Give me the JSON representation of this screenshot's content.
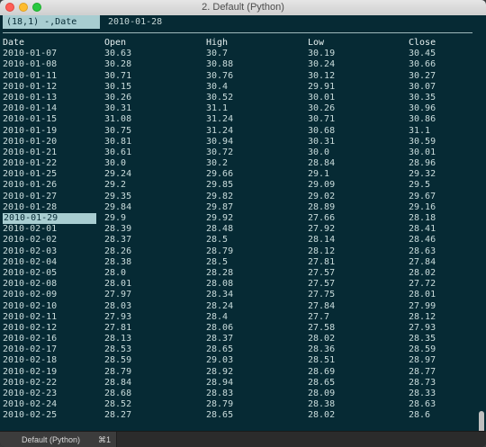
{
  "window": {
    "title": "2. Default (Python)"
  },
  "status": {
    "cell_ref": "(18,1) -,Date",
    "cell_value": "2010-01-28"
  },
  "table": {
    "columns": [
      "Date",
      "Open",
      "High",
      "Low",
      "Close"
    ],
    "selected_row_index": 15,
    "rows": [
      [
        "2010-01-07",
        "30.63",
        "30.7",
        "30.19",
        "30.45"
      ],
      [
        "2010-01-08",
        "30.28",
        "30.88",
        "30.24",
        "30.66"
      ],
      [
        "2010-01-11",
        "30.71",
        "30.76",
        "30.12",
        "30.27"
      ],
      [
        "2010-01-12",
        "30.15",
        "30.4",
        "29.91",
        "30.07"
      ],
      [
        "2010-01-13",
        "30.26",
        "30.52",
        "30.01",
        "30.35"
      ],
      [
        "2010-01-14",
        "30.31",
        "31.1",
        "30.26",
        "30.96"
      ],
      [
        "2010-01-15",
        "31.08",
        "31.24",
        "30.71",
        "30.86"
      ],
      [
        "2010-01-19",
        "30.75",
        "31.24",
        "30.68",
        "31.1"
      ],
      [
        "2010-01-20",
        "30.81",
        "30.94",
        "30.31",
        "30.59"
      ],
      [
        "2010-01-21",
        "30.61",
        "30.72",
        "30.0",
        "30.01"
      ],
      [
        "2010-01-22",
        "30.0",
        "30.2",
        "28.84",
        "28.96"
      ],
      [
        "2010-01-25",
        "29.24",
        "29.66",
        "29.1",
        "29.32"
      ],
      [
        "2010-01-26",
        "29.2",
        "29.85",
        "29.09",
        "29.5"
      ],
      [
        "2010-01-27",
        "29.35",
        "29.82",
        "29.02",
        "29.67"
      ],
      [
        "2010-01-28",
        "29.84",
        "29.87",
        "28.89",
        "29.16"
      ],
      [
        "2010-01-29",
        "29.9",
        "29.92",
        "27.66",
        "28.18"
      ],
      [
        "2010-02-01",
        "28.39",
        "28.48",
        "27.92",
        "28.41"
      ],
      [
        "2010-02-02",
        "28.37",
        "28.5",
        "28.14",
        "28.46"
      ],
      [
        "2010-02-03",
        "28.26",
        "28.79",
        "28.12",
        "28.63"
      ],
      [
        "2010-02-04",
        "28.38",
        "28.5",
        "27.81",
        "27.84"
      ],
      [
        "2010-02-05",
        "28.0",
        "28.28",
        "27.57",
        "28.02"
      ],
      [
        "2010-02-08",
        "28.01",
        "28.08",
        "27.57",
        "27.72"
      ],
      [
        "2010-02-09",
        "27.97",
        "28.34",
        "27.75",
        "28.01"
      ],
      [
        "2010-02-10",
        "28.03",
        "28.24",
        "27.84",
        "27.99"
      ],
      [
        "2010-02-11",
        "27.93",
        "28.4",
        "27.7",
        "28.12"
      ],
      [
        "2010-02-12",
        "27.81",
        "28.06",
        "27.58",
        "27.93"
      ],
      [
        "2010-02-16",
        "28.13",
        "28.37",
        "28.02",
        "28.35"
      ],
      [
        "2010-02-17",
        "28.53",
        "28.65",
        "28.36",
        "28.59"
      ],
      [
        "2010-02-18",
        "28.59",
        "29.03",
        "28.51",
        "28.97"
      ],
      [
        "2010-02-19",
        "28.79",
        "28.92",
        "28.69",
        "28.77"
      ],
      [
        "2010-02-22",
        "28.84",
        "28.94",
        "28.65",
        "28.73"
      ],
      [
        "2010-02-23",
        "28.68",
        "28.83",
        "28.09",
        "28.33"
      ],
      [
        "2010-02-24",
        "28.52",
        "28.79",
        "28.38",
        "28.63"
      ],
      [
        "2010-02-25",
        "28.27",
        "28.65",
        "28.02",
        "28.6"
      ]
    ]
  },
  "tab": {
    "label": "Default (Python)",
    "shortcut": "⌘1"
  },
  "colors": {
    "background": "#062a34",
    "text": "#c9dcdc",
    "highlight": "#a8cdd1"
  }
}
